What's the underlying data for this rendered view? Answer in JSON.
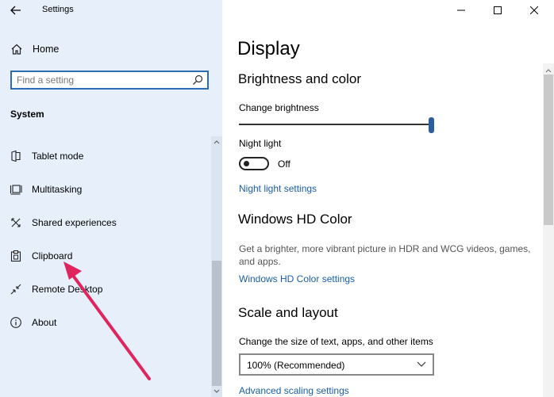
{
  "window": {
    "app_title": "Settings"
  },
  "sidebar": {
    "home_label": "Home",
    "search_placeholder": "Find a setting",
    "section_label": "System",
    "items": [
      {
        "label": "Tablet mode",
        "icon": "tablet-mode-icon"
      },
      {
        "label": "Multitasking",
        "icon": "multitasking-icon"
      },
      {
        "label": "Shared experiences",
        "icon": "shared-experiences-icon"
      },
      {
        "label": "Clipboard",
        "icon": "clipboard-icon"
      },
      {
        "label": "Remote Desktop",
        "icon": "remote-desktop-icon"
      },
      {
        "label": "About",
        "icon": "info-icon"
      }
    ]
  },
  "main": {
    "page_title": "Display",
    "brightness_section": {
      "heading": "Brightness and color",
      "change_brightness_label": "Change brightness",
      "brightness_value": 1.0,
      "night_light_label": "Night light",
      "night_light_state": "Off",
      "night_light_settings_link": "Night light settings"
    },
    "hd_color_section": {
      "heading": "Windows HD Color",
      "description": "Get a brighter, more vibrant picture in HDR and WCG videos, games, and apps.",
      "settings_link": "Windows HD Color settings"
    },
    "scale_section": {
      "heading": "Scale and layout",
      "change_size_label": "Change the size of text, apps, and other items",
      "selected_scale": "100% (Recommended)",
      "advanced_link": "Advanced scaling settings"
    }
  },
  "colors": {
    "sidebar_bg": "#e6effa",
    "accent": "#2b6cb8",
    "link": "#1a5ea8",
    "annotation_arrow": "#e0245e"
  }
}
